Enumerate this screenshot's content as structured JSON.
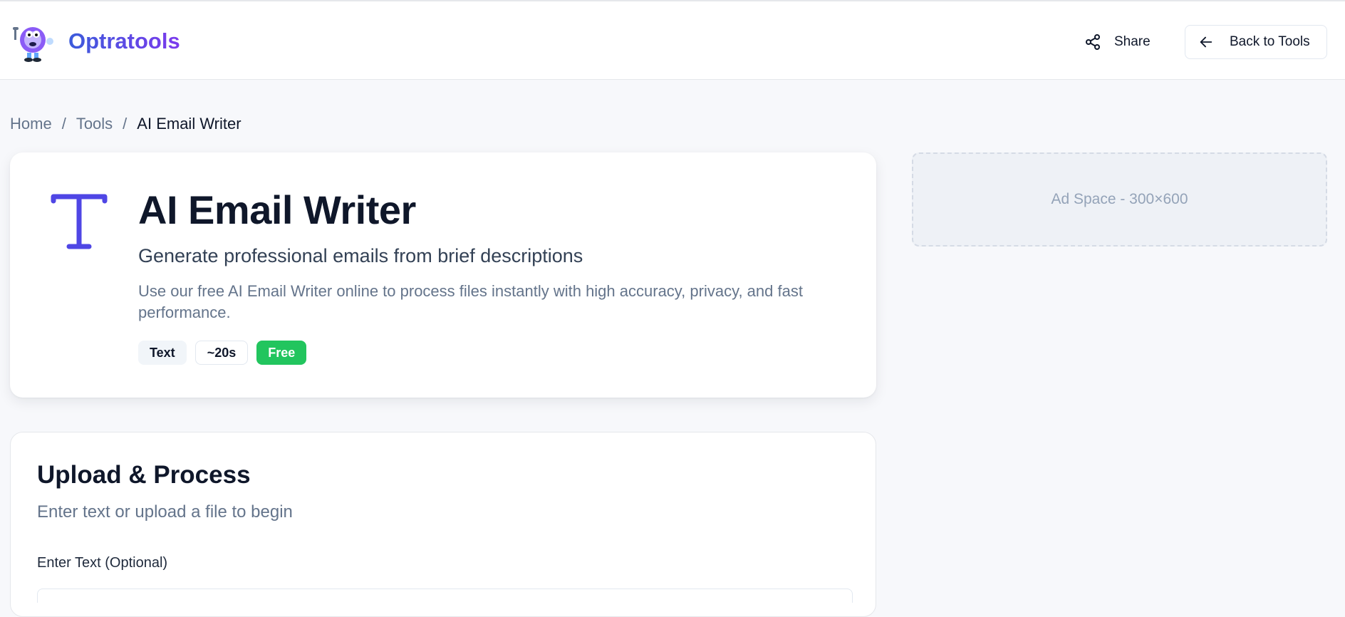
{
  "header": {
    "brand": "Optratools",
    "share_label": "Share",
    "back_label": "Back to Tools"
  },
  "breadcrumb": {
    "items": [
      "Home",
      "Tools",
      "AI Email Writer"
    ],
    "separator": "/"
  },
  "hero": {
    "icon": "text-type-icon",
    "title": "AI Email Writer",
    "subtitle": "Generate professional emails from brief descriptions",
    "description": "Use our free AI Email Writer online to process files instantly with high accuracy, privacy, and fast performance.",
    "tags": [
      "Text",
      "~20s",
      "Free"
    ]
  },
  "ad": {
    "label": "Ad Space - 300×600"
  },
  "upload": {
    "title": "Upload & Process",
    "subtitle": "Enter text or upload a file to begin",
    "text_label": "Enter Text (Optional)"
  },
  "colors": {
    "accent": "#4f46e5",
    "brand_gradient_start": "#3b5bdb",
    "brand_gradient_end": "#7c3aed",
    "free_badge": "#22c55e"
  }
}
